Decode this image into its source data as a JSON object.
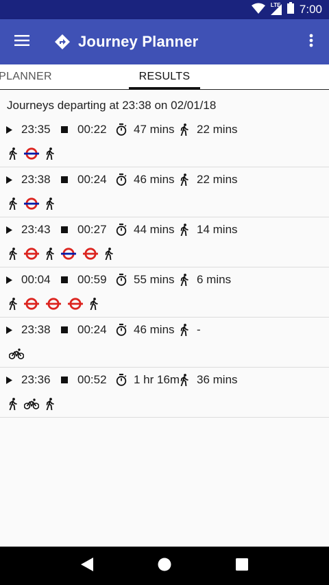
{
  "status_bar": {
    "network": "LTE",
    "time": "7:00"
  },
  "app_bar": {
    "title": "Journey Planner"
  },
  "tabs": [
    {
      "label": "PLANNER",
      "selected": false
    },
    {
      "label": "RESULTS",
      "selected": true
    }
  ],
  "results": {
    "departing_text": "Journeys departing at 23:38 on 02/01/18",
    "journeys": [
      {
        "depart": "23:35",
        "arrive": "00:22",
        "duration": "47 mins",
        "walking": "22 mins",
        "modes": [
          "walk",
          "tube-blue",
          "walk"
        ]
      },
      {
        "depart": "23:38",
        "arrive": "00:24",
        "duration": "46 mins",
        "walking": "22 mins",
        "modes": [
          "walk",
          "tube-blue",
          "walk"
        ]
      },
      {
        "depart": "23:43",
        "arrive": "00:27",
        "duration": "44 mins",
        "walking": "14 mins",
        "modes": [
          "walk",
          "tube-red",
          "walk",
          "tube-blue",
          "tube-red",
          "walk"
        ]
      },
      {
        "depart": "00:04",
        "arrive": "00:59",
        "duration": "55 mins",
        "walking": "6 mins",
        "modes": [
          "walk",
          "tube-red",
          "tube-red",
          "tube-red",
          "walk"
        ]
      },
      {
        "depart": "23:38",
        "arrive": "00:24",
        "duration": "46 mins",
        "walking": "-",
        "modes": [
          "bike"
        ]
      },
      {
        "depart": "23:36",
        "arrive": "00:52",
        "duration": "1 hr 16m",
        "walking": "36 mins",
        "modes": [
          "walk",
          "bike",
          "walk"
        ]
      }
    ]
  },
  "colors": {
    "primary": "#3f51b5",
    "primary_dark": "#1a237e",
    "tube_red": "#dc241f",
    "tube_blue": "#0019a8"
  }
}
